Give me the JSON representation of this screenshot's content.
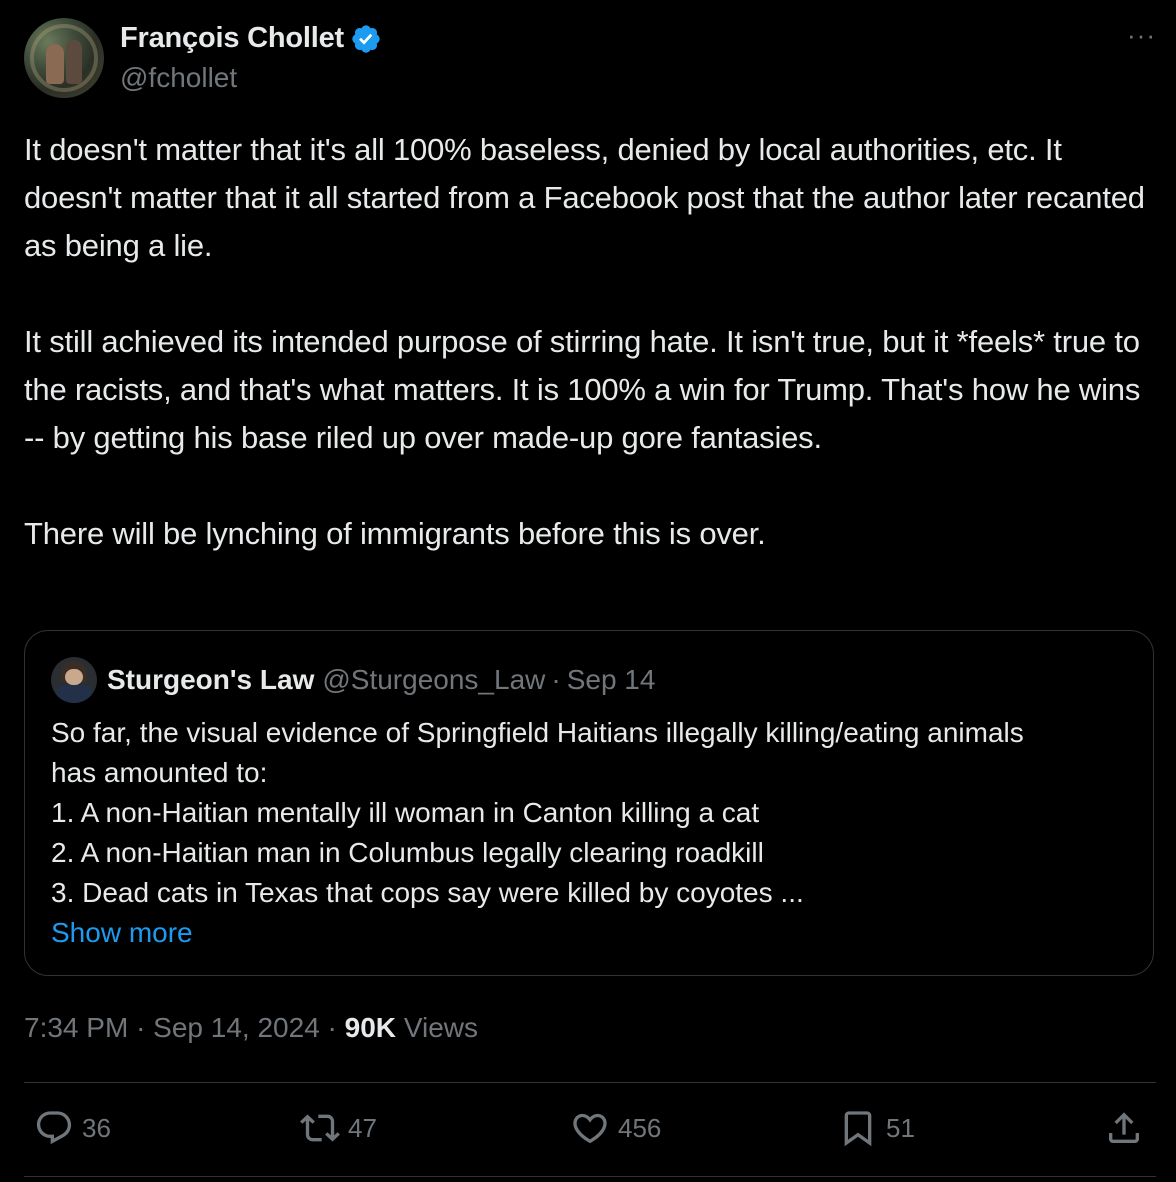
{
  "author": {
    "display_name": "François Chollet",
    "handle": "@fchollet",
    "verified": true
  },
  "more_icon": "more-options-icon",
  "tweet": {
    "paragraphs": [
      "It doesn't matter that it's all 100% baseless, denied by local authorities, etc. It doesn't matter that it all started from a Facebook post that the author later recanted as being a lie.",
      "It still achieved its intended purpose of stirring hate. It isn't true, but it *feels* true to the racists, and that's what matters. It is 100% a win for Trump. That's how he wins -- by getting his base riled up over made-up gore fantasies.",
      "There will be lynching of immigrants before this is over."
    ]
  },
  "quoted": {
    "display_name": "Sturgeon's Law",
    "handle": "@Sturgeons_Law",
    "separator": "·",
    "date": "Sep 14",
    "lines": [
      "So far, the visual evidence of Springfield Haitians illegally killing/eating animals",
      "has amounted to:",
      "1. A non-Haitian mentally ill woman in Canton killing a cat",
      "2. A non-Haitian man in Columbus legally clearing roadkill",
      "3. Dead cats in Texas that cops say were killed by coyotes ..."
    ],
    "show_more": "Show more"
  },
  "meta": {
    "time": "7:34 PM",
    "separator": "·",
    "date": "Sep 14, 2024",
    "views_count": "90K",
    "views_label": "Views"
  },
  "actions": {
    "replies": "36",
    "reposts": "47",
    "likes": "456",
    "bookmarks": "51"
  },
  "colors": {
    "background": "#000000",
    "text": "#e7e9ea",
    "secondary": "#71767b",
    "accent": "#1d9bf0",
    "border": "#2f3336"
  }
}
